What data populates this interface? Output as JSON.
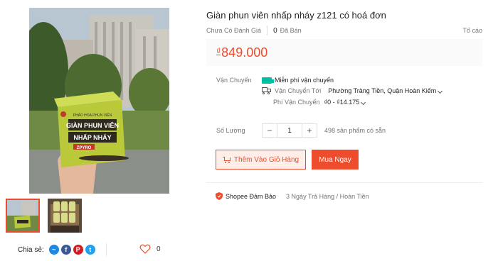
{
  "product": {
    "title": "Giàn phun viên nhấp nháy z121 có hoá đơn",
    "rating_text": "Chưa Có Đánh Giá",
    "sold_count": "0",
    "sold_label": "Đã Bán",
    "report_label": "Tố cáo",
    "price_currency": "₫",
    "price": "849.000",
    "box_text": {
      "small": "PHÁO HOA PHUN VIÊN",
      "line1": "GIÀN PHUN VIÊN",
      "line2": "NHẤP NHÁY",
      "brand": "ZPYRO"
    }
  },
  "shipping": {
    "label": "Vận Chuyển",
    "free_label": "Miễn phí vận chuyển",
    "to_label": "Vận Chuyển Tới",
    "address": "Phường Tràng Tiền, Quận Hoàn Kiếm",
    "fee_label": "Phí Vận Chuyển",
    "fee_value": "₫0 - ₫14.175"
  },
  "quantity": {
    "label": "Số Lượng",
    "minus": "−",
    "value": "1",
    "plus": "+",
    "stock": "498 sản phẩm có sẵn"
  },
  "actions": {
    "add_to_cart": "Thêm Vào Giỏ Hàng",
    "buy_now": "Mua Ngay"
  },
  "guarantee": {
    "title": "Shopee Đảm Bảo",
    "desc": "3 Ngày Trả Hàng / Hoàn Tiền"
  },
  "share": {
    "label": "Chia sẻ:",
    "icons": [
      "messenger-icon",
      "facebook-icon",
      "pinterest-icon",
      "twitter-icon"
    ]
  },
  "favorite": {
    "count": "0"
  },
  "colors": {
    "accent": "#ee4d2d",
    "free_ship": "#00bfa5"
  }
}
